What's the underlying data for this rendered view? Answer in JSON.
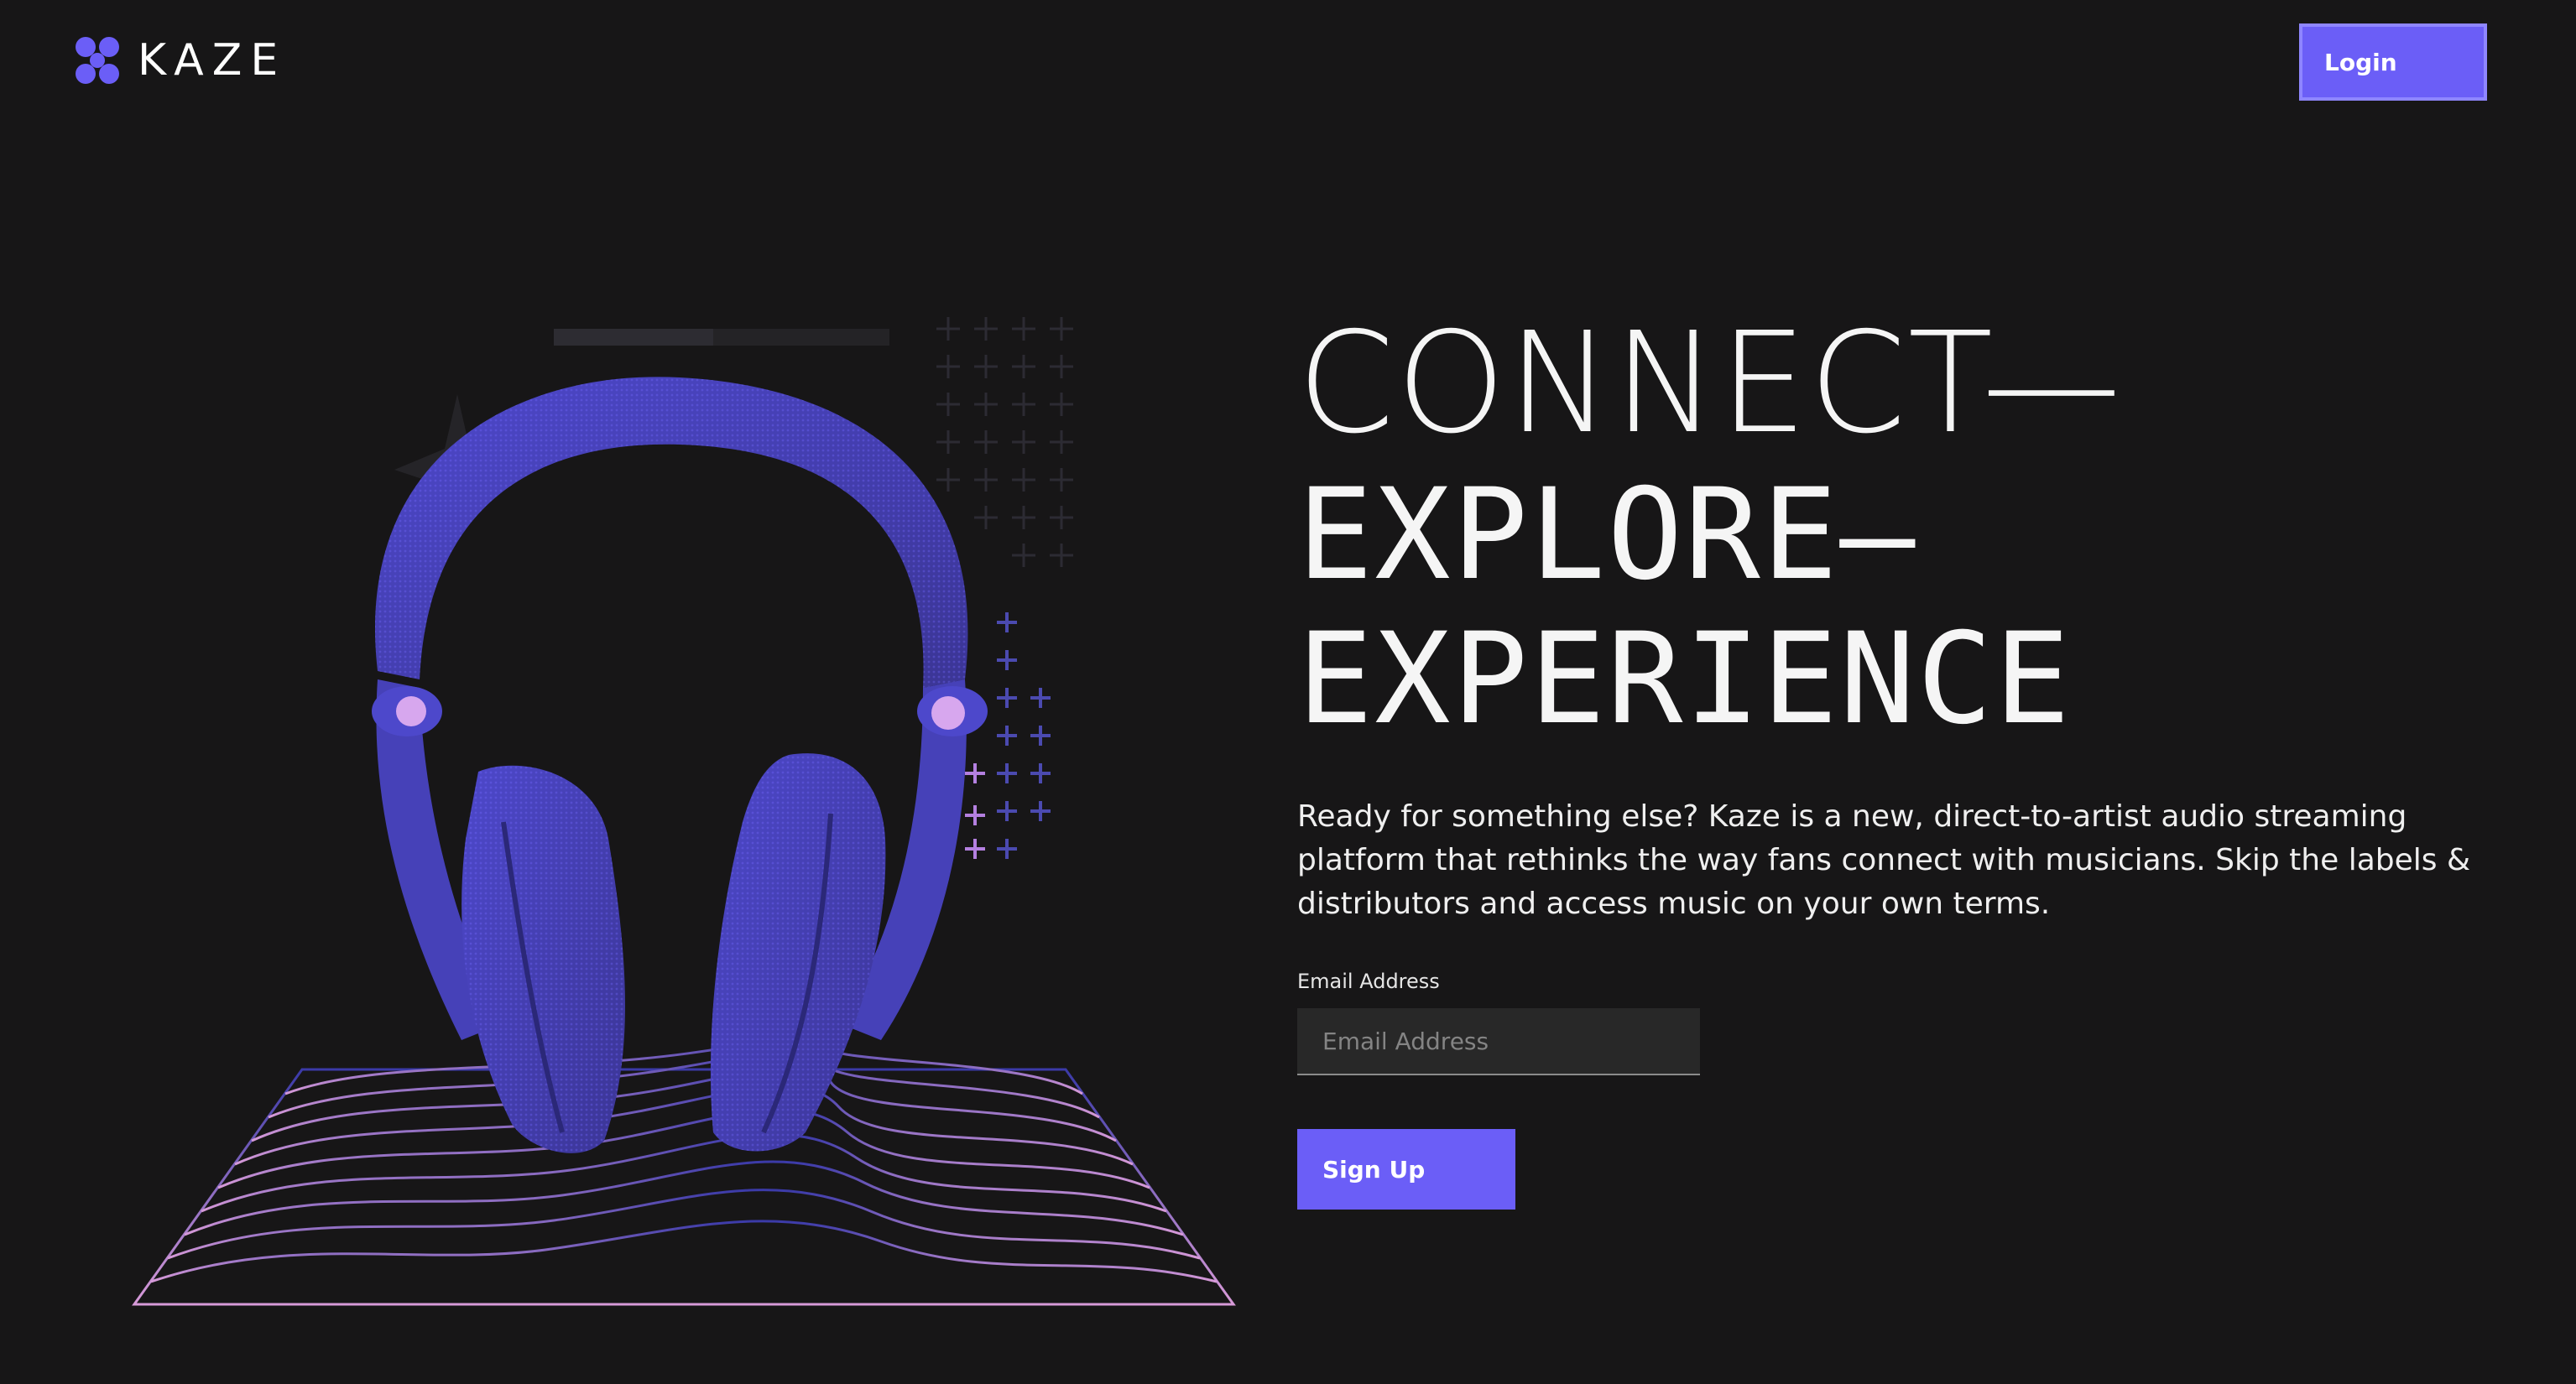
{
  "brand": {
    "name": "KAZE",
    "accent_color": "#6b5ef7"
  },
  "header": {
    "login_label": "Login"
  },
  "hero": {
    "headline": [
      "CONNECT—",
      "EXPLORE—",
      "EXPERIENCE"
    ],
    "description": "Ready for something else? Kaze is a new, direct-to-artist audio streaming platform that rethinks the way fans connect with musicians. Skip the labels & distributors and access music on your own terms.",
    "illustration": "headphones-illustration"
  },
  "signup_form": {
    "email_label": "Email Address",
    "email_placeholder": "Email Address",
    "email_value": "",
    "submit_label": "Sign Up"
  }
}
